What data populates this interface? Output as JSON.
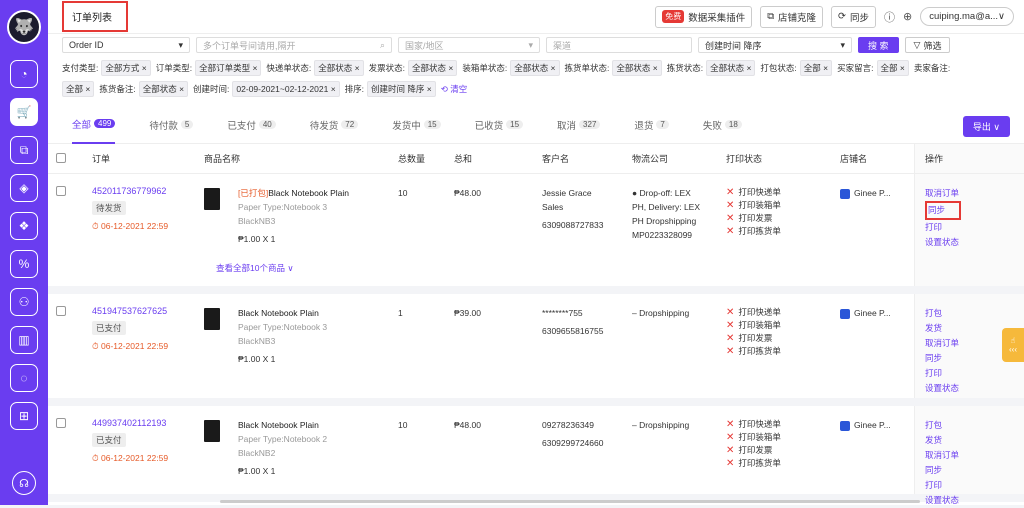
{
  "sidebar": {
    "icons": [
      "palette-icon",
      "cart-icon",
      "hierarchy-icon",
      "box-icon",
      "dropbox-icon",
      "percent-icon",
      "users-icon",
      "chart-icon",
      "chat-icon",
      "import-icon"
    ],
    "help_icon": "headset-icon"
  },
  "topbar": {
    "title": "订单列表",
    "free_badge": "免费",
    "plugin_label": "数据采集插件",
    "clone_label": "店铺克隆",
    "sync_label": "同步",
    "user": "cuiping.ma@a...∨"
  },
  "search": {
    "type_select": "Order ID",
    "order_placeholder": "多个订单号间请用,隔开",
    "country_placeholder": "国家/地区",
    "channel_placeholder": "渠道",
    "sort_select": "创建时间 降序",
    "search_button": "搜 索",
    "filter_button": "筛选"
  },
  "filters": {
    "row1": [
      {
        "label": "支付类型:",
        "value": "全部方式 ×"
      },
      {
        "label": "订单类型:",
        "value": "全部订单类型 ×"
      },
      {
        "label": "快递单状态:",
        "value": "全部状态 ×"
      },
      {
        "label": "发票状态:",
        "value": "全部状态 ×"
      },
      {
        "label": "装箱单状态:",
        "value": "全部状态 ×"
      },
      {
        "label": "拣货单状态:",
        "value": "全部状态 ×"
      },
      {
        "label": "拣货状态:",
        "value": "全部状态 ×"
      },
      {
        "label": "打包状态:",
        "value": "全部 ×"
      },
      {
        "label": "买家留言:",
        "value": "全部 ×"
      },
      {
        "label": "卖家备注:",
        "value": ""
      }
    ],
    "row2": [
      {
        "label": "",
        "value": "全部 ×"
      },
      {
        "label": "拣货备注:",
        "value": "全部状态 ×"
      },
      {
        "label": "创建时间:",
        "value": "02-09-2021~02-12-2021 ×"
      },
      {
        "label": "排序:",
        "value": "创建时间 降序 ×"
      }
    ],
    "clear": "⟲ 清空"
  },
  "tabs": [
    {
      "label": "全部",
      "count": "499",
      "active": true
    },
    {
      "label": "待付款",
      "count": "5"
    },
    {
      "label": "已支付",
      "count": "40"
    },
    {
      "label": "待发货",
      "count": "72"
    },
    {
      "label": "发货中",
      "count": "15"
    },
    {
      "label": "已收货",
      "count": "15"
    },
    {
      "label": "取消",
      "count": "327"
    },
    {
      "label": "退货",
      "count": "7"
    },
    {
      "label": "失败",
      "count": "18"
    }
  ],
  "export_label": "导出 ∨",
  "columns": {
    "order": "订单",
    "product": "商品名称",
    "qty": "总数量",
    "sum": "总和",
    "customer": "客户名",
    "logistics": "物流公司",
    "print": "打印状态",
    "store": "店铺名",
    "ops": "操作"
  },
  "orders": [
    {
      "id": "452011736779962",
      "status": "待发货",
      "time": "⏱ 06-12-2021 22:59",
      "tag": "[已打包]",
      "name": "Black Notebook Plain",
      "variant": "Paper Type:Notebook 3",
      "sku": "BlackNB3",
      "price": "₱1.00 X 1",
      "qty": "10",
      "sum": "₱48.00",
      "customer": [
        "Jessie Grace",
        "Sales",
        "6309088727833"
      ],
      "logistics": [
        "● Drop-off: LEX",
        "PH, Delivery: LEX",
        "PH Dropshipping",
        "MP0223328099"
      ],
      "print": [
        "打印快递单",
        "打印装箱单",
        "打印发票",
        "打印拣货单"
      ],
      "store": "Ginee P...",
      "ops": [
        "取消订单",
        "同步",
        "打印",
        "设置状态"
      ],
      "more": "查看全部10个商品 ∨"
    },
    {
      "id": "451947537627625",
      "status": "已支付",
      "time": "⏱ 06-12-2021 22:59",
      "tag": "",
      "name": "Black Notebook Plain",
      "variant": "Paper Type:Notebook 3",
      "sku": "BlackNB3",
      "price": "₱1.00 X 1",
      "qty": "1",
      "sum": "₱39.00",
      "customer": [
        "********755",
        "6309655816755"
      ],
      "logistics": [
        "– Dropshipping"
      ],
      "print": [
        "打印快递单",
        "打印装箱单",
        "打印发票",
        "打印拣货单"
      ],
      "store": "Ginee P...",
      "ops": [
        "打包",
        "发货",
        "取消订单",
        "同步",
        "打印",
        "设置状态"
      ]
    },
    {
      "id": "449937402112193",
      "status": "已支付",
      "time": "⏱ 06-12-2021 22:59",
      "tag": "",
      "name": "Black Notebook Plain",
      "variant": "Paper Type:Notebook 2",
      "sku": "BlackNB2",
      "price": "₱1.00 X 1",
      "qty": "10",
      "sum": "₱48.00",
      "customer": [
        "09278236349",
        "6309299724660"
      ],
      "logistics": [
        "– Dropshipping"
      ],
      "print": [
        "打印快递单",
        "打印装箱单",
        "打印发票",
        "打印拣货单"
      ],
      "store": "Ginee P...",
      "ops": [
        "打包",
        "发货",
        "取消订单",
        "同步",
        "打印",
        "设置状态"
      ]
    }
  ],
  "side_fab": "‹‹‹"
}
